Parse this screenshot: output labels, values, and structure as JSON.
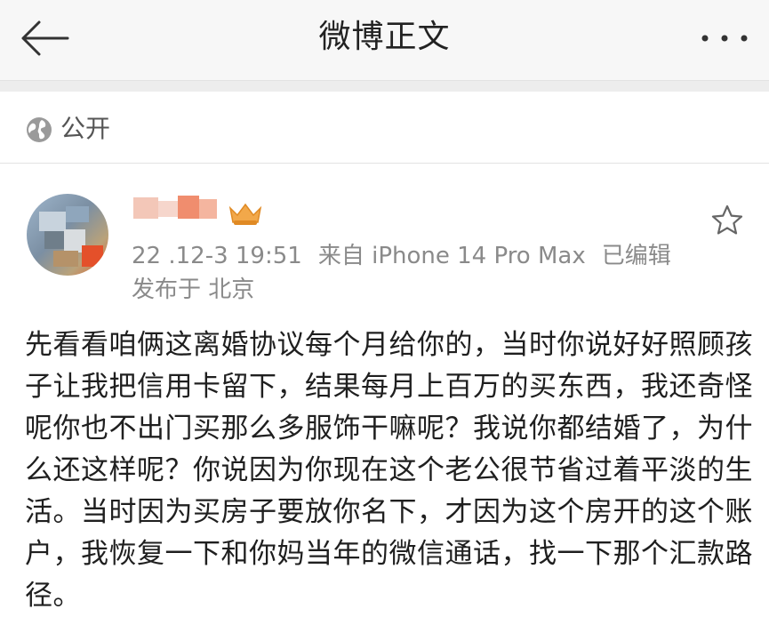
{
  "header": {
    "title": "微博正文",
    "back_icon": "arrow-left-icon",
    "more_icon": "more-dots-icon"
  },
  "visibility": {
    "icon": "globe-icon",
    "label": "公开"
  },
  "post": {
    "date": "22 .12-3 19:51",
    "source": "来自 iPhone 14 Pro Max",
    "edited": "已编辑",
    "location": "发布于 北京",
    "favorite_icon": "star-outline-icon",
    "text": "先看看咱俩这离婚协议每个月给你的，当时你说好好照顾孩子让我把信用卡留下，结果每月上百万的买东西，我还奇怪呢你也不出门买那么多服饰干嘛呢？我说你都结婚了，为什么还这样呢？你说因为你现在这个老公很节省过着平淡的生活。当时因为买房子要放你名下，才因为这个房开的这个账户，我恢复一下和你妈当年的微信通话，找一下那个汇款路径。"
  }
}
